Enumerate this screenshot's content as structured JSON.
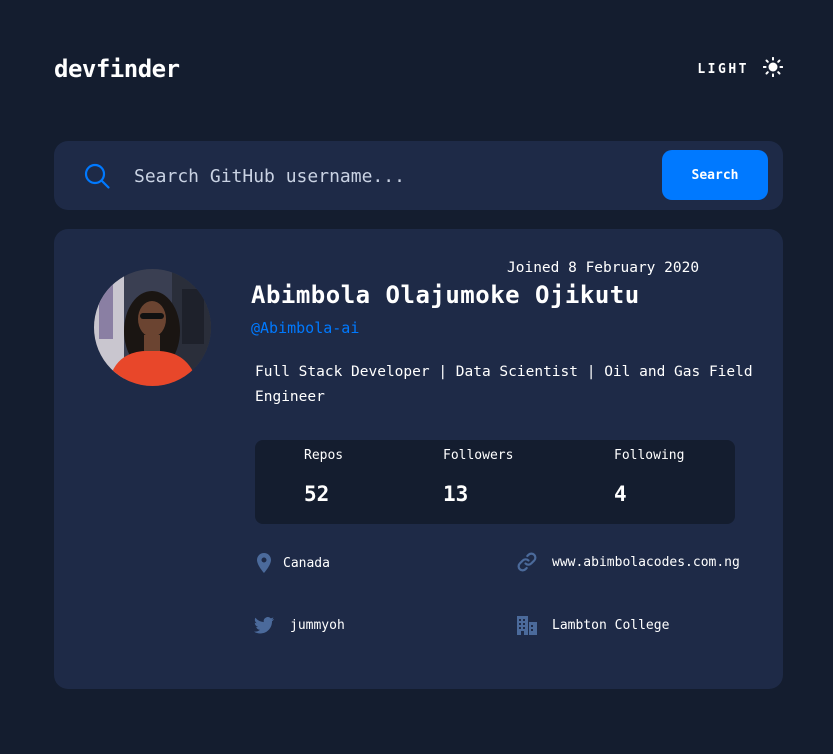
{
  "header": {
    "logo": "devfinder",
    "theme_toggle_label": "LIGHT",
    "theme_toggle_icon": "sun-icon"
  },
  "search": {
    "placeholder": "Search GitHub username...",
    "value": "",
    "button_label": "Search",
    "icon": "search-icon"
  },
  "profile": {
    "name": "Abimbola Olajumoke Ojikutu",
    "login": "@Abimbola-ai",
    "joined": "Joined 8 February 2020",
    "bio": "Full Stack Developer | Data Scientist | Oil and Gas Field Engineer",
    "stats": {
      "repos_label": "Repos",
      "repos": "52",
      "followers_label": "Followers",
      "followers": "13",
      "following_label": "Following",
      "following": "4"
    },
    "links": {
      "location": "Canada",
      "website": "www.abimbolacodes.com.ng",
      "twitter": "jummyoh",
      "company": "Lambton College"
    }
  },
  "colors": {
    "background": "#141d2f",
    "card": "#1e2a47",
    "accent": "#0079ff",
    "icon_muted": "#4b6a9b"
  }
}
